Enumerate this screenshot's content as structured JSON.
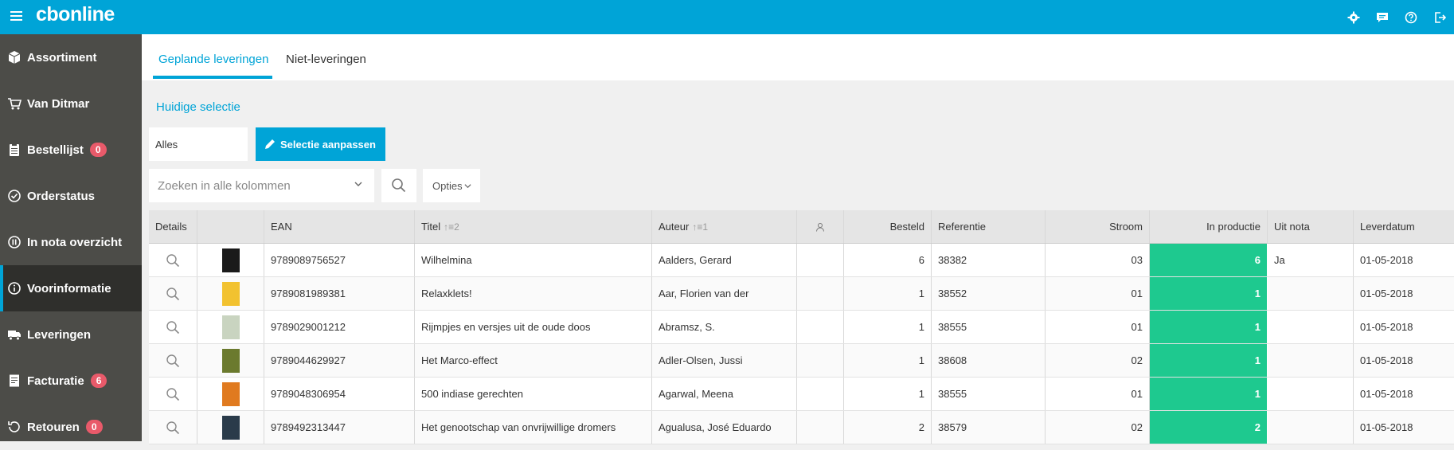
{
  "app": {
    "logo": "cbonline"
  },
  "sidebar": {
    "items": [
      {
        "label": "Assortiment",
        "icon": "box-icon",
        "badge": ""
      },
      {
        "label": "Van Ditmar",
        "icon": "cart-icon",
        "badge": ""
      },
      {
        "label": "Bestellijst",
        "icon": "clipboard-icon",
        "badge": "0"
      },
      {
        "label": "Orderstatus",
        "icon": "check-circle-icon",
        "badge": ""
      },
      {
        "label": "In nota overzicht",
        "icon": "pause-circle-icon",
        "badge": ""
      },
      {
        "label": "Voorinformatie",
        "icon": "info-icon",
        "badge": "",
        "active": true
      },
      {
        "label": "Leveringen",
        "icon": "truck-icon",
        "badge": ""
      },
      {
        "label": "Facturatie",
        "icon": "invoice-icon",
        "badge": "6"
      },
      {
        "label": "Retouren",
        "icon": "return-icon",
        "badge": "0"
      }
    ]
  },
  "tabs": [
    {
      "label": "Geplande leveringen",
      "active": true
    },
    {
      "label": "Niet-leveringen",
      "active": false
    }
  ],
  "selection": {
    "title": "Huidige selectie",
    "value": "Alles",
    "button": "Selectie aanpassen"
  },
  "search": {
    "placeholder": "Zoeken in alle kolommen",
    "options_label": "Opties"
  },
  "table": {
    "headers": {
      "details": "Details",
      "ean": "EAN",
      "titel": "Titel",
      "titel_sort": "2",
      "auteur": "Auteur",
      "auteur_sort": "1",
      "besteld": "Besteld",
      "referentie": "Referentie",
      "stroom": "Stroom",
      "in_productie": "In productie",
      "uit_nota": "Uit nota",
      "leverdatum": "Leverdatum"
    },
    "rows": [
      {
        "ean": "9789089756527",
        "titel": "Wilhelmina",
        "auteur": "Aalders, Gerard",
        "besteld": "6",
        "referentie": "38382",
        "stroom": "03",
        "in_productie": "6",
        "uit_nota": "Ja",
        "leverdatum": "01-05-2018",
        "cover_color": "#1a1a1a"
      },
      {
        "ean": "9789081989381",
        "titel": "Relaxklets!",
        "auteur": "Aar, Florien van der",
        "besteld": "1",
        "referentie": "38552",
        "stroom": "01",
        "in_productie": "1",
        "uit_nota": "",
        "leverdatum": "01-05-2018",
        "cover_color": "#f2c230"
      },
      {
        "ean": "9789029001212",
        "titel": "Rijmpjes en versjes uit de oude doos",
        "auteur": "Abramsz, S.",
        "besteld": "1",
        "referentie": "38555",
        "stroom": "01",
        "in_productie": "1",
        "uit_nota": "",
        "leverdatum": "01-05-2018",
        "cover_color": "#c9d4c0"
      },
      {
        "ean": "9789044629927",
        "titel": "Het Marco-effect",
        "auteur": "Adler-Olsen, Jussi",
        "besteld": "1",
        "referentie": "38608",
        "stroom": "02",
        "in_productie": "1",
        "uit_nota": "",
        "leverdatum": "01-05-2018",
        "cover_color": "#6b7a2e"
      },
      {
        "ean": "9789048306954",
        "titel": "500 indiase gerechten",
        "auteur": "Agarwal, Meena",
        "besteld": "1",
        "referentie": "38555",
        "stroom": "01",
        "in_productie": "1",
        "uit_nota": "",
        "leverdatum": "01-05-2018",
        "cover_color": "#e07a1f"
      },
      {
        "ean": "9789492313447",
        "titel": "Het genootschap van onvrijwillige dromers",
        "auteur": "Agualusa, José Eduardo",
        "besteld": "2",
        "referentie": "38579",
        "stroom": "02",
        "in_productie": "2",
        "uit_nota": "",
        "leverdatum": "01-05-2018",
        "cover_color": "#2a3b4a"
      }
    ]
  },
  "colors": {
    "accent": "#00a4d7",
    "sidebar": "#4c4c48",
    "green": "#1ec98f",
    "badge": "#e95a6a"
  }
}
